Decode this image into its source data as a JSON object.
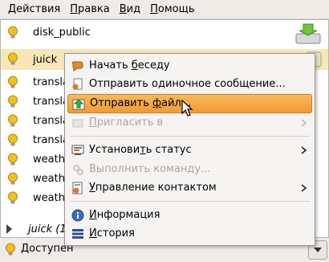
{
  "menubar": {
    "items": [
      {
        "label": "Действия",
        "mnemonic": "Д",
        "rest": "ействия"
      },
      {
        "label": "Правка",
        "mnemonic": "П",
        "rest": "равка"
      },
      {
        "label": "Вид",
        "mnemonic": "В",
        "rest": "ид"
      },
      {
        "label": "Помощь",
        "mnemonic": "П",
        "rest": "омощь"
      }
    ]
  },
  "contacts": {
    "rows": [
      {
        "name": "disk_public",
        "icon": "disk-icon"
      },
      {
        "name": "juick",
        "icon": "info-icon",
        "selected": true
      },
      {
        "name": "translate"
      },
      {
        "name": "translate"
      },
      {
        "name": "translate"
      },
      {
        "name": "translate"
      },
      {
        "name": "weather"
      },
      {
        "name": "weather"
      },
      {
        "name": "weather"
      }
    ],
    "group": {
      "name": "juick (1"
    }
  },
  "context_menu": {
    "items": [
      {
        "pre": "Начать ",
        "u": "б",
        "post": "еседу",
        "icon": "chat-icon"
      },
      {
        "pre": "Отправить одиночное сообщение...",
        "u": "",
        "post": "",
        "icon": "message-icon"
      },
      {
        "pre": "Отправить ",
        "u": "ф",
        "post": "айл...",
        "icon": "send-file-icon",
        "highlighted": true
      },
      {
        "pre": "",
        "u": "П",
        "post": "ригласить в",
        "icon": "invite-icon",
        "disabled": true,
        "submenu": true
      },
      {
        "pre": "Установи",
        "u": "т",
        "post": "ь статус",
        "icon": "status-icon",
        "submenu": true
      },
      {
        "pre": "Выполнить команду...",
        "u": "",
        "post": "",
        "icon": "command-icon",
        "disabled": true
      },
      {
        "pre": "",
        "u": "У",
        "post": "правление контактом",
        "icon": "manage-contact-icon",
        "submenu": true
      },
      {
        "pre": "",
        "u": "И",
        "post": "нформация",
        "icon": "info-icon"
      },
      {
        "pre": "",
        "u": "И",
        "post": "стория",
        "icon": "history-icon"
      }
    ]
  },
  "status": {
    "label": "Доступен"
  },
  "colors": {
    "bulb": "#f2c21b",
    "highlight": "#f19a33",
    "selected_row": "#f8e6b8"
  }
}
